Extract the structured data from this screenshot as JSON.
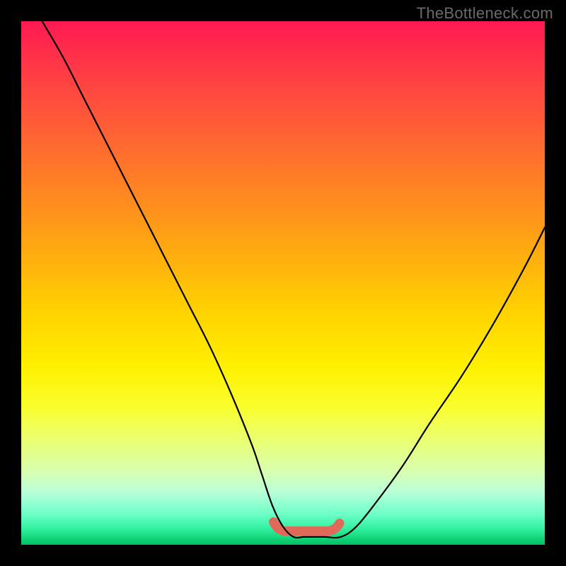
{
  "watermark": {
    "text": "TheBottleneck.com"
  },
  "colors": {
    "curve": "#000000",
    "highlight": "#e06a5a",
    "highlight_shadow": "rgba(0,0,0,0.15)"
  },
  "chart_data": {
    "type": "line",
    "title": "",
    "xlabel": "",
    "ylabel": "",
    "xlim": [
      0,
      100
    ],
    "ylim": [
      0,
      100
    ],
    "grid": false,
    "note": "V-shaped bottleneck curve on a gradient background. Y is read as height above the bottom green band (0 = at the minimum, 100 = at the top). X is normalized left-to-right.",
    "series": [
      {
        "name": "bottleneck-curve",
        "x": [
          4,
          8,
          12,
          16,
          20,
          24,
          28,
          32,
          36,
          40,
          44,
          46,
          48,
          50,
          52,
          54,
          56,
          58,
          61,
          64,
          68,
          73,
          78,
          84,
          90,
          96,
          100
        ],
        "y": [
          100,
          93,
          85,
          77,
          69,
          61,
          53,
          45,
          37,
          28,
          18,
          12,
          6,
          2,
          0,
          0,
          0,
          0,
          0,
          2,
          7,
          14,
          22,
          31,
          41,
          52,
          60
        ]
      }
    ],
    "highlight": {
      "description": "Soft red rounded segment marking the flat minimum region",
      "x_range": [
        49,
        60
      ],
      "y": 1
    }
  }
}
